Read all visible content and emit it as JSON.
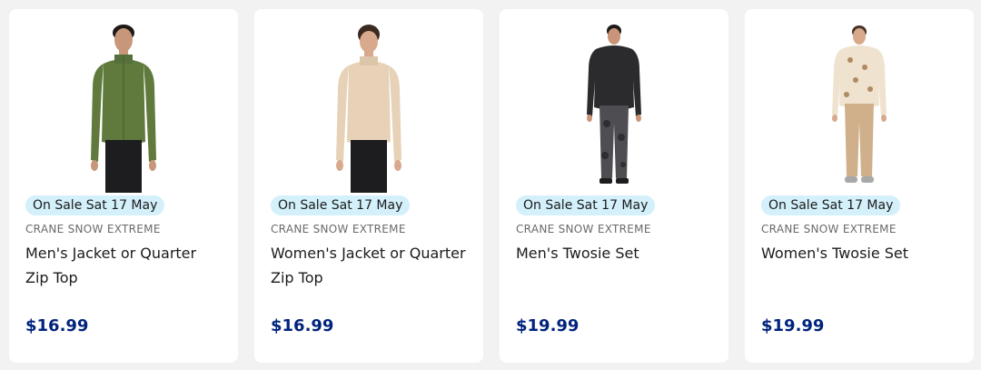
{
  "products": [
    {
      "badge": "On Sale Sat 17 May",
      "brand": "CRANE SNOW EXTREME",
      "title": "Men's Jacket or Quarter Zip Top",
      "price": "$16.99",
      "colors": {
        "top": "#5f7a3c",
        "bottom": "#1d1d1f",
        "skin": "#c8977a",
        "hair": "#1d1a18"
      }
    },
    {
      "badge": "On Sale Sat 17 May",
      "brand": "CRANE SNOW EXTREME",
      "title": "Women's Jacket or Quarter Zip Top",
      "price": "$16.99",
      "colors": {
        "top": "#e7d2b8",
        "bottom": "#1d1d1f",
        "skin": "#d8a98c",
        "hair": "#3b2a21"
      }
    },
    {
      "badge": "On Sale Sat 17 May",
      "brand": "CRANE SNOW EXTREME",
      "title": "Men's Twosie Set",
      "price": "$19.99",
      "colors": {
        "top": "#2b2b2e",
        "bottom": "#4d4d52",
        "skin": "#c99478",
        "hair": "#1d1a18"
      }
    },
    {
      "badge": "On Sale Sat 17 May",
      "brand": "CRANE SNOW EXTREME",
      "title": "Women's Twosie Set",
      "price": "$19.99",
      "colors": {
        "top": "#efe3cf",
        "bottom": "#cfb08a",
        "skin": "#d9a98c",
        "hair": "#4a3428"
      }
    }
  ]
}
